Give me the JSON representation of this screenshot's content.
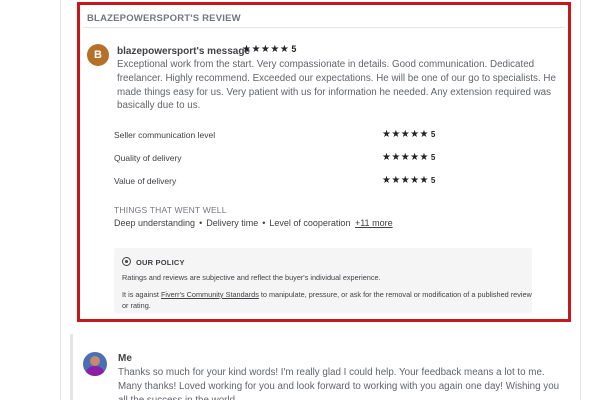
{
  "review": {
    "title": "BLAZEPOWERSPORT'S REVIEW",
    "avatar_letter": "B",
    "author_label": "blazepowersport's message",
    "overall_stars": "★★★★★",
    "overall_rating": "5",
    "overall_rating_value": 5,
    "message": "Exceptional work from the start. Very compassionate in details. Good communication. Dedicated freelancer. Highly recommend. Exceeded our expectations. He will be one of our go to specialists. He made things easy for us. Very patient with us for information he needed. Any extension required was basically due to us.",
    "ratings": [
      {
        "label": "Seller communication level",
        "stars": "★★★★★",
        "value": "5"
      },
      {
        "label": "Quality of delivery",
        "stars": "★★★★★",
        "value": "5"
      },
      {
        "label": "Value of delivery",
        "stars": "★★★★★",
        "value": "5"
      }
    ],
    "went_well": {
      "title": "THINGS THAT WENT WELL",
      "items": [
        "Deep understanding",
        "Delivery time",
        "Level of cooperation"
      ],
      "separator": "•",
      "more_link": "+11 more"
    },
    "policy": {
      "title": "OUR POLICY",
      "line1": "Ratings and reviews are subjective and reflect the buyer's individual experience.",
      "line2_before": "It is against ",
      "line2_link": "Fiverr's Community Standards",
      "line2_after": " to manipulate, pressure, or ask for the removal or modification of a published review or rating."
    }
  },
  "reply": {
    "author": "Me",
    "message": "Thanks so much for your kind words! I'm really glad I could help. Your feedback means a lot to me. Many thanks! Loved working for you and look forward to working with you again one day! Wishing you all the success in the world."
  },
  "colors": {
    "highlight_border": "#c8171a",
    "avatar_bg": "#b5702a",
    "policy_bg": "#f5f5f5"
  },
  "icons": {
    "star": "star-icon",
    "policy": "shield-icon",
    "reply_avatar": "user-avatar"
  }
}
